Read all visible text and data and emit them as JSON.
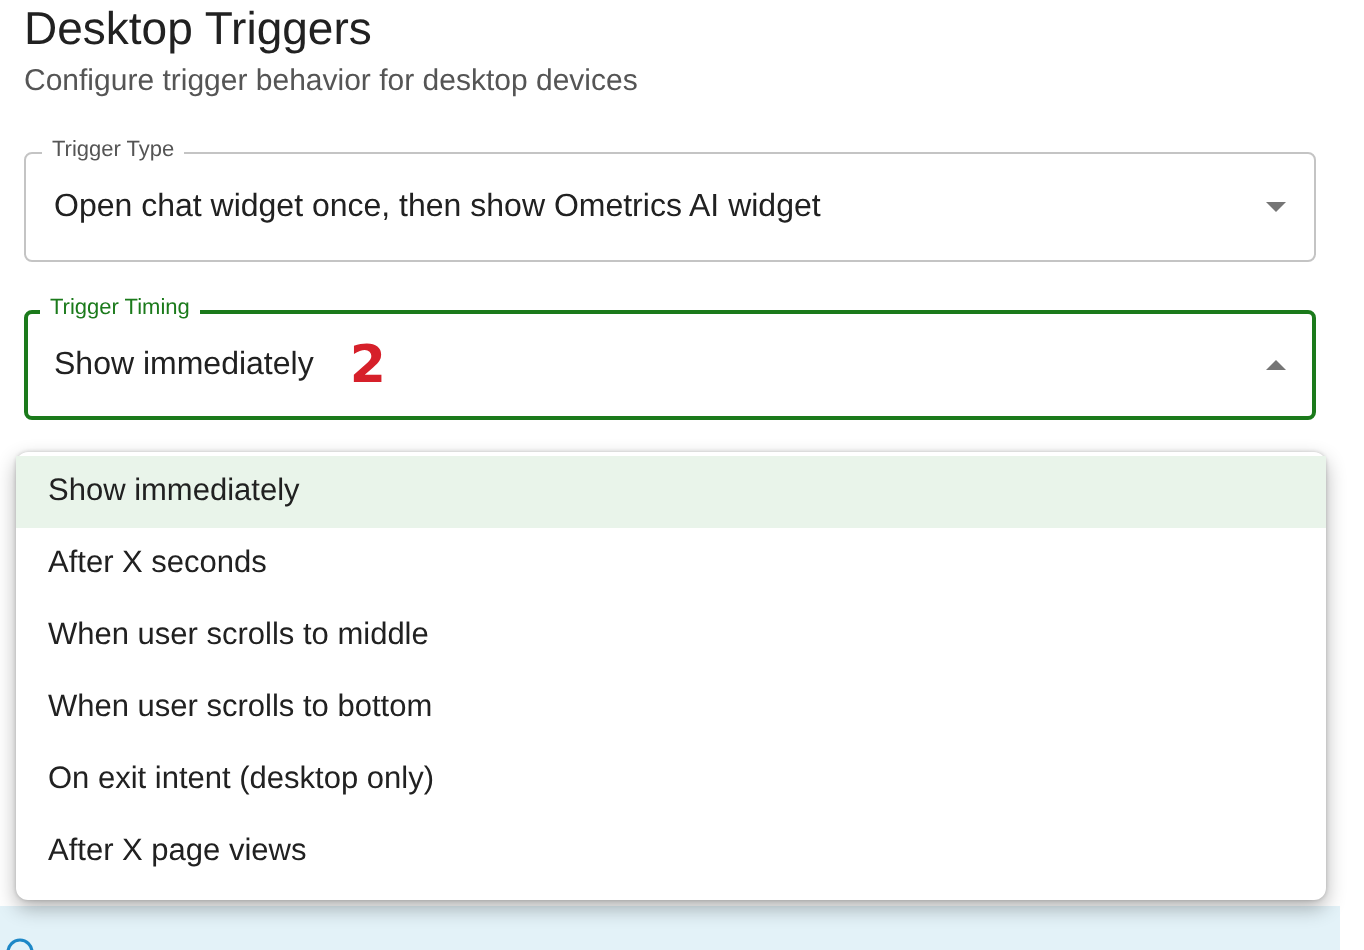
{
  "header": {
    "title": "Desktop Triggers",
    "subtitle": "Configure trigger behavior for desktop devices"
  },
  "fields": [
    {
      "label": "Trigger Type",
      "value": "Open chat widget once, then show Ometrics AI widget",
      "focused": false,
      "expanded": false
    },
    {
      "label": "Trigger Timing",
      "value": "Show immediately",
      "focused": true,
      "expanded": true,
      "annotation": "2"
    }
  ],
  "menu": {
    "options": [
      {
        "label": "Show immediately",
        "selected": true
      },
      {
        "label": "After X seconds",
        "selected": false
      },
      {
        "label": "When user scrolls to middle",
        "selected": false
      },
      {
        "label": "When user scrolls to bottom",
        "selected": false
      },
      {
        "label": "On exit intent (desktop only)",
        "selected": false
      },
      {
        "label": "After X page views",
        "selected": false
      }
    ]
  },
  "info_banner": {
    "kind": "info"
  }
}
